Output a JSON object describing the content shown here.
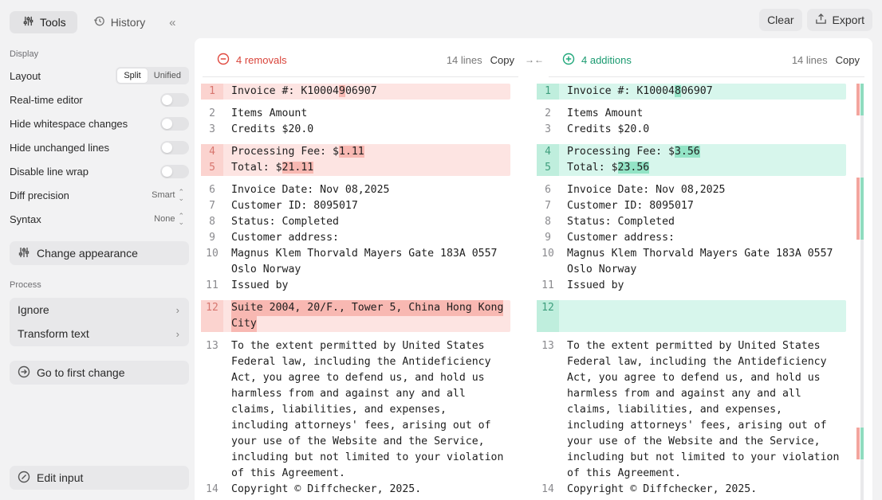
{
  "tabs": [
    {
      "label": "Tools",
      "active": true
    },
    {
      "label": "History",
      "active": false
    }
  ],
  "collapse_glyph": "«",
  "top_actions": {
    "clear": "Clear",
    "export": "Export"
  },
  "sidebar": {
    "display_label": "Display",
    "layout": {
      "label": "Layout",
      "options": [
        "Split",
        "Unified"
      ],
      "selected": "Split"
    },
    "toggles": [
      {
        "label": "Real-time editor",
        "on": false
      },
      {
        "label": "Hide whitespace changes",
        "on": false
      },
      {
        "label": "Hide unchanged lines",
        "on": false
      },
      {
        "label": "Disable line wrap",
        "on": false
      }
    ],
    "diff_precision": {
      "label": "Diff precision",
      "value": "Smart"
    },
    "syntax": {
      "label": "Syntax",
      "value": "None"
    },
    "change_appearance": "Change appearance",
    "process_label": "Process",
    "process_items": [
      "Ignore",
      "Transform text"
    ],
    "go_first_change": "Go to first change",
    "edit_input": "Edit input"
  },
  "left_pane": {
    "summary": "4 removals",
    "line_count": "14 lines",
    "copy": "Copy"
  },
  "right_pane": {
    "summary": "4 additions",
    "line_count": "14 lines",
    "copy": "Copy"
  },
  "colors": {
    "removal": "#e0483e",
    "addition": "#1fa77a",
    "removal_bg": "#fde4e2",
    "addition_bg": "#d7f6ec"
  },
  "left_lines": {
    "l1_pre": "Invoice #: K10004",
    "l1_hl": "9",
    "l1_post": "06907",
    "l2": "Items Amount",
    "l3": "Credits $20.0",
    "l4_pre": "Processing Fee: $",
    "l4_hl": "1.11",
    "l5_pre": "Total: $",
    "l5_hl": "21.11",
    "l6": "Invoice Date: Nov 08,2025",
    "l7": "Customer ID: 8095017",
    "l8": "Status: Completed",
    "l9": "Customer address:",
    "l10a": "Magnus Klem Thorvald Mayers Gate 183A 0557",
    "l10b": "Oslo Norway",
    "l11": "Issued by",
    "l12a": "Suite 2004, 20/F., Tower 5, China Hong Kong",
    "l12b": "City",
    "l13": [
      "To the extent permitted by United States",
      "Federal law, including the Antideficiency",
      "Act, you agree to defend us, and hold us",
      "harmless from and against any and all",
      "claims, liabilities, and expenses,",
      "including attorneys' fees, arising out of",
      "your use of the Website and the Service,",
      "including but not limited to your violation",
      "of this Agreement."
    ],
    "l14": "Copyright © Diffchecker, 2025."
  },
  "right_lines": {
    "l1_pre": "Invoice #: K10004",
    "l1_hl": "8",
    "l1_post": "06907",
    "l2": "Items Amount",
    "l3": "Credits $20.0",
    "l4_pre": "Processing Fee: $",
    "l4_hl": "3.56",
    "l5_pre": "Total: $",
    "l5_hl": "23.56",
    "l6": "Invoice Date: Nov 08,2025",
    "l7": "Customer ID: 8095017",
    "l8": "Status: Completed",
    "l9": "Customer address:",
    "l10a": "Magnus Klem Thorvald Mayers Gate 183A 0557",
    "l10b": "Oslo Norway",
    "l11": "Issued by",
    "l13": [
      "To the extent permitted by United States",
      "Federal law, including the Antideficiency",
      "Act, you agree to defend us, and hold us",
      "harmless from and against any and all",
      "claims, liabilities, and expenses,",
      "including attorneys' fees, arising out of",
      "your use of the Website and the Service,",
      "including but not limited to your violation",
      "of this Agreement."
    ],
    "l14": "Copyright © Diffchecker, 2025."
  },
  "line_numbers": [
    "1",
    "2",
    "3",
    "4",
    "5",
    "6",
    "7",
    "8",
    "9",
    "10",
    "11",
    "12",
    "13",
    "14"
  ]
}
